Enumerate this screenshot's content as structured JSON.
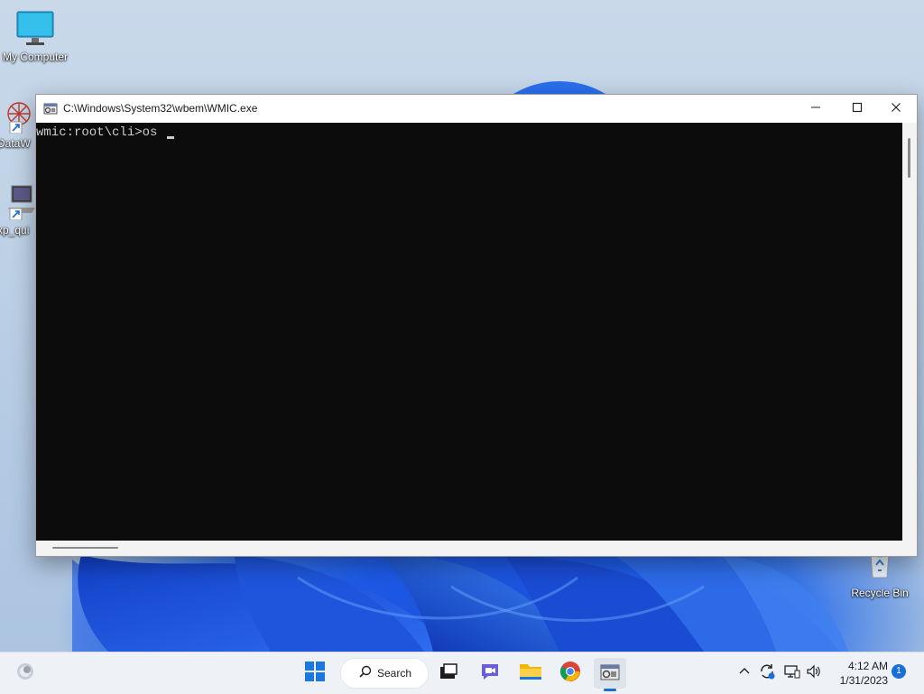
{
  "desktop": {
    "icons": [
      {
        "label": "My Computer",
        "icon": "monitor-icon"
      },
      {
        "label": "DataW",
        "icon": "datawrapper-shortcut-icon"
      },
      {
        "label": "xp_qui",
        "icon": "laptop-shortcut-icon"
      },
      {
        "label": "Recycle Bin",
        "icon": "recycle-bin-icon"
      }
    ]
  },
  "window": {
    "title": "C:\\Windows\\System32\\wbem\\WMIC.exe",
    "controls": {
      "minimize": "—",
      "maximize": "☐",
      "close": "✕"
    },
    "console": {
      "prompt": "wmic:root\\cli>",
      "input": "os "
    }
  },
  "taskbar": {
    "search_label": "Search",
    "apps": [
      {
        "name": "start",
        "icon": "windows-logo-icon"
      },
      {
        "name": "search",
        "icon": "search-icon"
      },
      {
        "name": "task-view",
        "icon": "task-view-icon"
      },
      {
        "name": "chat",
        "icon": "teams-chat-icon"
      },
      {
        "name": "file-explorer",
        "icon": "folder-icon"
      },
      {
        "name": "chrome",
        "icon": "chrome-icon"
      },
      {
        "name": "wmic",
        "icon": "wmic-console-icon",
        "active": true
      }
    ],
    "tray": {
      "time": "4:12 AM",
      "date": "1/31/2023",
      "notification_count": "1"
    },
    "accent": "#1a6fd6"
  }
}
